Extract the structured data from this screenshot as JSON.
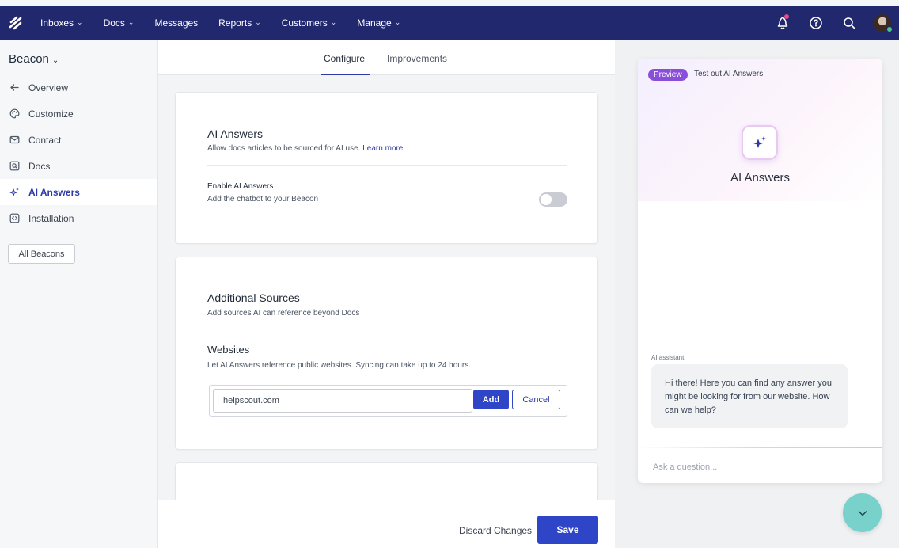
{
  "topnav": {
    "items": [
      {
        "label": "Inboxes",
        "has_dropdown": true
      },
      {
        "label": "Docs",
        "has_dropdown": true
      },
      {
        "label": "Messages",
        "has_dropdown": false
      },
      {
        "label": "Reports",
        "has_dropdown": true
      },
      {
        "label": "Customers",
        "has_dropdown": true
      },
      {
        "label": "Manage",
        "has_dropdown": true
      }
    ],
    "icons": [
      "notifications-icon",
      "help-icon",
      "search-icon",
      "avatar"
    ],
    "bg_color": "#22286d"
  },
  "sidebar": {
    "title": "Beacon",
    "items": [
      {
        "label": "Overview",
        "icon": "arrow-left-icon",
        "active": false
      },
      {
        "label": "Customize",
        "icon": "palette-icon",
        "active": false
      },
      {
        "label": "Contact",
        "icon": "envelope-icon",
        "active": false
      },
      {
        "label": "Docs",
        "icon": "docs-search-icon",
        "active": false
      },
      {
        "label": "AI Answers",
        "icon": "sparkle-icon",
        "active": true
      },
      {
        "label": "Installation",
        "icon": "code-icon",
        "active": false
      }
    ],
    "all_beacons_label": "All Beacons"
  },
  "tabs": [
    {
      "label": "Configure",
      "active": true
    },
    {
      "label": "Improvements",
      "active": false
    }
  ],
  "ai_answers": {
    "title": "AI Answers",
    "description": "Allow docs articles to be sourced for AI use.",
    "learn_more": "Learn more",
    "enable_label": "Enable AI Answers",
    "enable_help": "Add the chatbot to your Beacon",
    "enabled": false
  },
  "additional_sources": {
    "title": "Additional Sources",
    "description": "Add sources AI can reference beyond Docs",
    "websites_title": "Websites",
    "websites_description": "Let AI Answers reference public websites. Syncing can take up to 24 hours.",
    "url_value": "helpscout.com",
    "add_label": "Add",
    "cancel_label": "Cancel"
  },
  "footer": {
    "discard_label": "Discard Changes",
    "save_label": "Save"
  },
  "preview": {
    "badge": "Preview",
    "title": "Test out AI Answers",
    "heading": "AI Answers",
    "assistant_label": "AI assistant",
    "message": "Hi there! Here you can find any answer you might be looking for from our website. How can we help?",
    "input_placeholder": "Ask a question..."
  },
  "colors": {
    "accent": "#2e45c7",
    "preview_badge": "#8a4fd8",
    "fab": "#79d1cc"
  }
}
